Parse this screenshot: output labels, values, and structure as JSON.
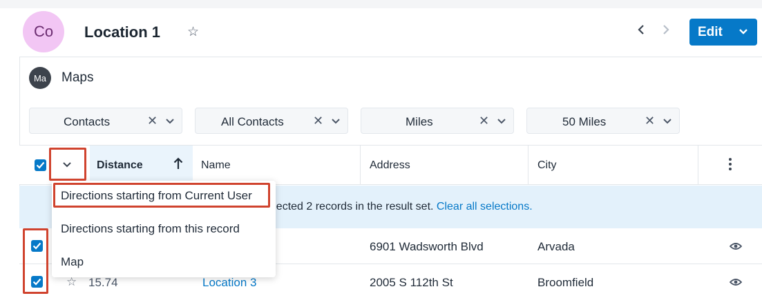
{
  "header": {
    "avatar_initials": "Co",
    "title": "Location 1",
    "edit_label": "Edit"
  },
  "dashlet": {
    "avatar_initials": "Ma",
    "title": "Maps"
  },
  "filters": [
    {
      "value": "Contacts"
    },
    {
      "value": "All Contacts"
    },
    {
      "value": "Miles"
    },
    {
      "value": "50 Miles"
    }
  ],
  "table": {
    "columns": {
      "distance": "Distance",
      "name": "Name",
      "address": "Address",
      "city": "City"
    },
    "sort": "ascending",
    "selection_text": "e selected 2 records in the result set.",
    "clear_selection": "Clear all selections.",
    "rows": [
      {
        "distance": "",
        "name": "",
        "address": "6901 Wadsworth Blvd",
        "city": "Arvada",
        "checked": true
      },
      {
        "distance": "15.74",
        "name": "Location 3",
        "address": "2005 S 112th St",
        "city": "Broomfield",
        "checked": true
      }
    ]
  },
  "menu": {
    "items": [
      {
        "label": "Directions starting from Current User"
      },
      {
        "label": "Directions starting from this record"
      },
      {
        "label": "Map"
      }
    ]
  },
  "colors": {
    "accent": "#0679c8",
    "highlight": "#d0432e",
    "selection_bg": "#e3f1fb",
    "avatar_co": "#f2c6f4"
  },
  "icons": [
    "star-icon",
    "chevron-left-icon",
    "chevron-right-icon",
    "chevron-down-icon",
    "clear-x-icon",
    "arrow-up-icon",
    "kebab-icon",
    "eye-icon",
    "checkbox-icon"
  ]
}
